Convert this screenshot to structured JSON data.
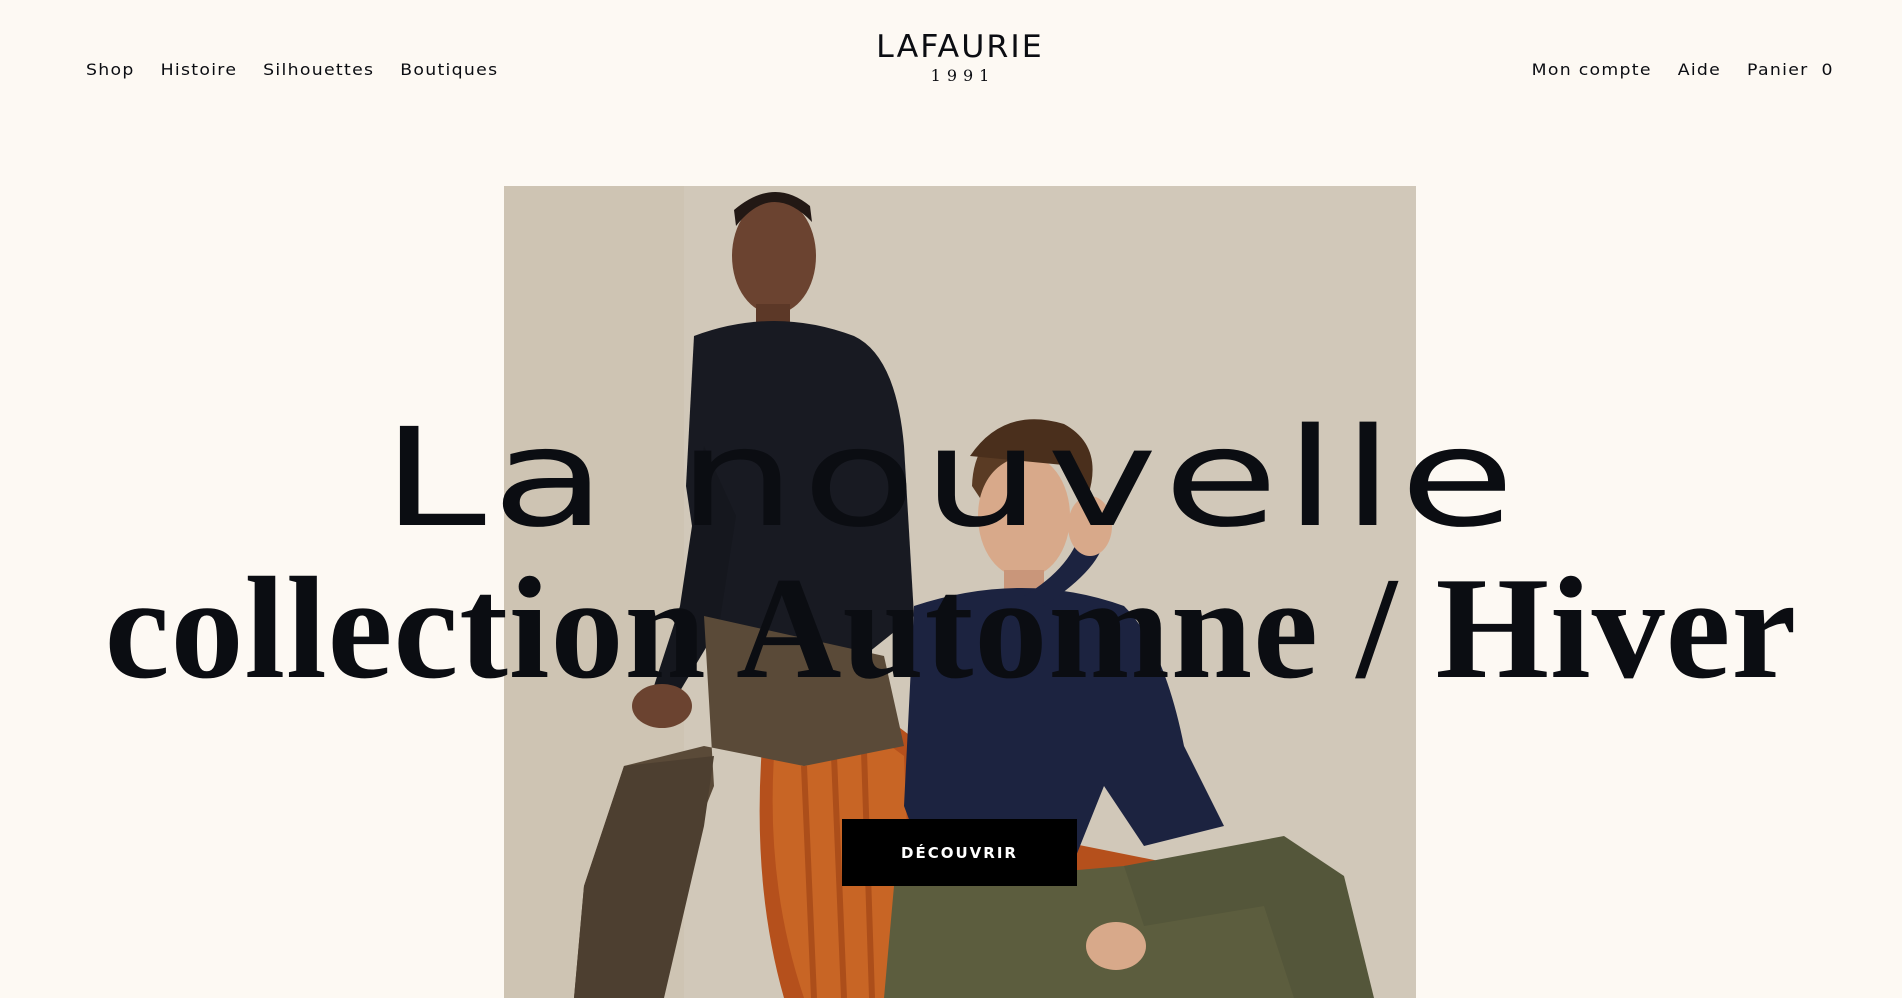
{
  "header": {
    "nav_left": [
      "Shop",
      "Histoire",
      "Silhouettes",
      "Boutiques"
    ],
    "logo": {
      "name": "LAFAURIE",
      "year": "1991"
    },
    "nav_right": {
      "account": "Mon compte",
      "help": "Aide",
      "cart_label": "Panier",
      "cart_count": "0"
    }
  },
  "hero": {
    "headline_line1": "La nouvelle",
    "headline_line2": "collection Automne / Hiver",
    "cta_label": "DÉCOUVRIR"
  },
  "colors": {
    "background": "#fdf9f3",
    "text": "#0b0d12",
    "cta_background": "#000000",
    "cta_text": "#ffffff"
  }
}
